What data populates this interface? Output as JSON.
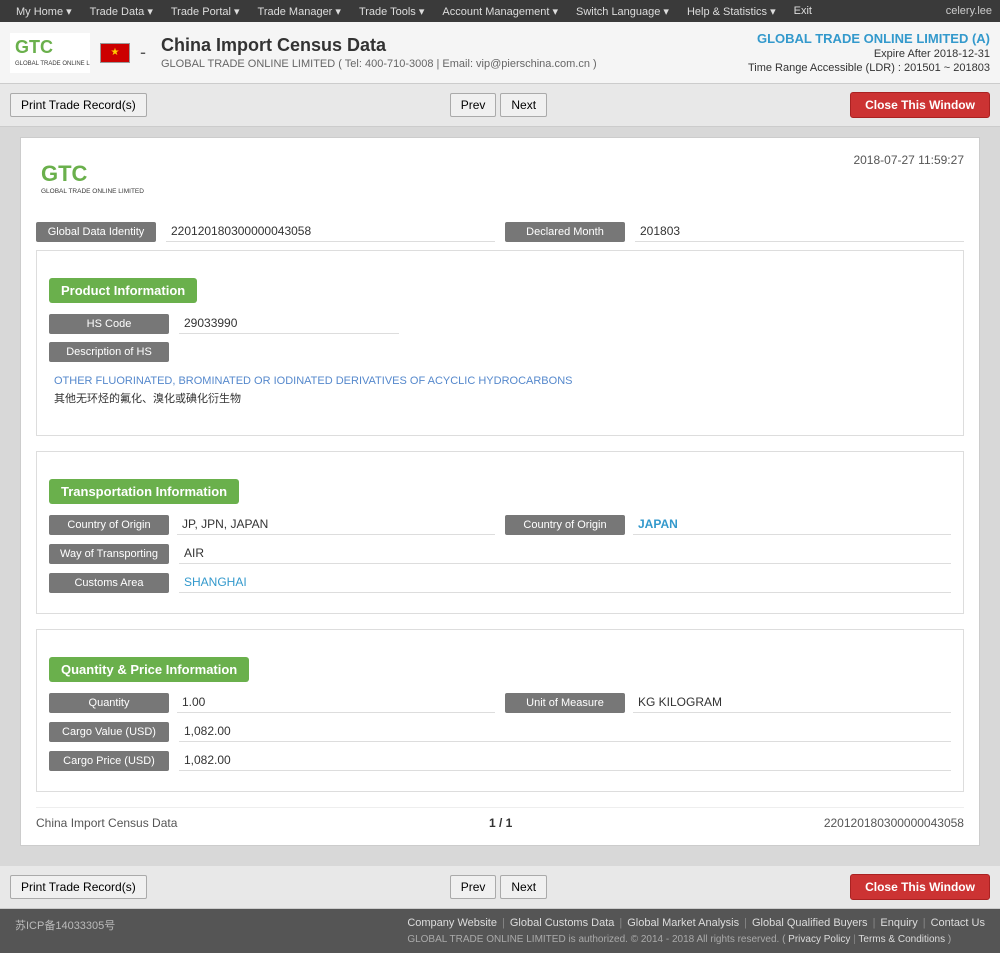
{
  "topnav": {
    "items": [
      "My Home",
      "Trade Data",
      "Trade Portal",
      "Trade Manager",
      "Trade Tools",
      "Account Management",
      "Switch Language",
      "Help & Statistics",
      "Exit"
    ],
    "user": "celery.lee"
  },
  "header": {
    "title": "China Import Census Data",
    "dash": "-",
    "company_info": "GLOBAL TRADE ONLINE LIMITED ( Tel: 400-710-3008 | Email: vip@pierschina.com.cn )",
    "right_link": "GLOBAL TRADE ONLINE LIMITED (A)",
    "expire": "Expire After 2018-12-31",
    "time_range": "Time Range Accessible (LDR) : 201501 ~ 201803"
  },
  "toolbar": {
    "print_label": "Print Trade Record(s)",
    "prev_label": "Prev",
    "next_label": "Next",
    "close_label": "Close This Window"
  },
  "record": {
    "timestamp": "2018-07-27 11:59:27",
    "global_data_identity_label": "Global Data Identity",
    "global_data_identity_value": "220120180300000043058",
    "declared_month_label": "Declared Month",
    "declared_month_value": "201803",
    "product_section_label": "Product Information",
    "hs_code_label": "HS Code",
    "hs_code_value": "29033990",
    "desc_hs_label": "Description of HS",
    "desc_hs_en": "OTHER FLUORINATED, BROMINATED OR IODINATED DERIVATIVES OF ACYCLIC HYDROCARBONS",
    "desc_hs_cn": "其他无环烃的氟化、溴化或碘化衍生物",
    "transport_section_label": "Transportation Information",
    "country_origin_label": "Country of Origin",
    "country_origin_value": "JP, JPN, JAPAN",
    "country_origin_label2": "Country of Origin",
    "country_origin_value2": "JAPAN",
    "way_transport_label": "Way of Transporting",
    "way_transport_value": "AIR",
    "customs_area_label": "Customs Area",
    "customs_area_value": "SHANGHAI",
    "qty_section_label": "Quantity & Price Information",
    "quantity_label": "Quantity",
    "quantity_value": "1.00",
    "unit_measure_label": "Unit of Measure",
    "unit_measure_value": "KG KILOGRAM",
    "cargo_value_label": "Cargo Value (USD)",
    "cargo_value_value": "1,082.00",
    "cargo_price_label": "Cargo Price (USD)",
    "cargo_price_value": "1,082.00",
    "footer_left": "China Import Census Data",
    "footer_center": "1 / 1",
    "footer_right": "220120180300000043058"
  },
  "footer": {
    "icp": "苏ICP备14033305号",
    "links": [
      "Company Website",
      "Global Customs Data",
      "Global Market Analysis",
      "Global Qualified Buyers",
      "Enquiry",
      "Contact Us"
    ],
    "copyright": "GLOBAL TRADE ONLINE LIMITED is authorized. © 2014 - 2018 All rights reserved.",
    "privacy": "Privacy Policy",
    "separator": "|",
    "terms": "Terms & Conditions",
    "conditions_text": "Conditions"
  }
}
